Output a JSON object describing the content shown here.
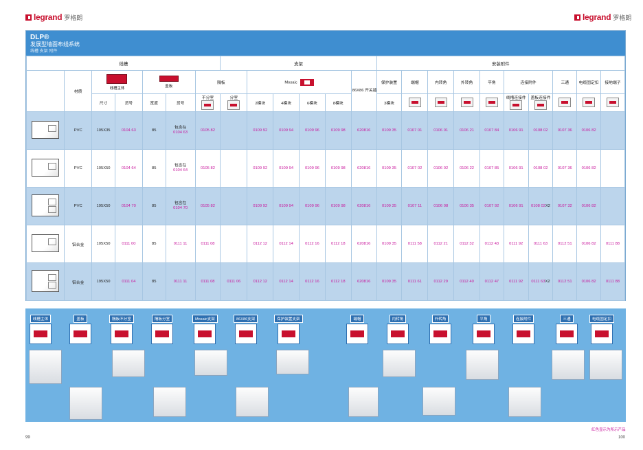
{
  "brand": {
    "word": "legrand",
    "cn": "罗格朗"
  },
  "header": {
    "title": "DLP®",
    "subtitle": "发展型墙面布线系统",
    "crumb": "线槽  支架  附件"
  },
  "groups": {
    "trunking": "线槽",
    "bracket": "支架",
    "accessories": "安装附件"
  },
  "columns": {
    "body": "线槽主体",
    "cover": "盖板",
    "divider": "隔板",
    "mosaic": "Mosaic",
    "box86": "86X86 开关插座",
    "protect": "保护装置",
    "endcap": "端帽",
    "inner": "内转角",
    "outer": "外转角",
    "flat": "平角",
    "joint": "连接附件",
    "tee": "三通",
    "clip": "电缆固定扣",
    "earth": "接地端子",
    "joint_body": "线槽连接件",
    "joint_cover": "盖板连接件"
  },
  "sublabels": {
    "material": "材质",
    "size": "尺寸",
    "code": "货号",
    "width": "宽度",
    "cover_code": "货号",
    "no_div": "不分室",
    "div": "分室",
    "m2": "2模块",
    "m4": "4模块",
    "m6": "6模块",
    "m8": "8模块",
    "p3": "3模块"
  },
  "rows": [
    {
      "mat": "PVC",
      "size": "105X35",
      "code": "0104 63",
      "w": "85",
      "cov_a": "包含在",
      "cov_b": "0104 63",
      "nodiv": "0105 82",
      "div": "",
      "m2": "0109 92",
      "m4": "0109 94",
      "m6": "0109 96",
      "m8": "0109 98",
      "box": "620816",
      "prot": "0109 35",
      "end": "0107 01",
      "inner": "0106 01",
      "outer": "0106 21",
      "flat": "0107 84",
      "jb": "0106 91",
      "jc": "0108 02",
      "jcx": "",
      "tee": "0107 36",
      "clip": "0106 82",
      "earth": ""
    },
    {
      "mat": "PVC",
      "size": "105X50",
      "code": "0104 64",
      "w": "85",
      "cov_a": "包含在",
      "cov_b": "0104 64",
      "nodiv": "0105 82",
      "div": "",
      "m2": "0109 92",
      "m4": "0109 94",
      "m6": "0109 96",
      "m8": "0109 98",
      "box": "620816",
      "prot": "0109 35",
      "end": "0107 02",
      "inner": "0106 02",
      "outer": "0106 22",
      "flat": "0107 85",
      "jb": "0106 91",
      "jc": "0108 02",
      "jcx": "",
      "tee": "0107 36",
      "clip": "0106 82",
      "earth": ""
    },
    {
      "mat": "PVC",
      "size": "195X50",
      "code": "0104 70",
      "w": "85",
      "cov_a": "包含在",
      "cov_b": "0104 70",
      "nodiv": "0105 82",
      "div": "",
      "m2": "0109 92",
      "m4": "0109 94",
      "m6": "0109 96",
      "m8": "0109 98",
      "box": "620816",
      "prot": "0109 35",
      "end": "0107 11",
      "inner": "0106 08",
      "outer": "0106 35",
      "flat": "0107 92",
      "jb": "0106 91",
      "jc": "0108 02",
      "jcx": "X2",
      "tee": "0107 32",
      "clip": "0106 82",
      "earth": ""
    },
    {
      "mat": "铝合金",
      "size": "105X50",
      "code": "0111 00",
      "w": "85",
      "cov_a": "",
      "cov_b": "0111 11",
      "nodiv": "0111 08",
      "div": "",
      "m2": "0112 12",
      "m4": "0112 14",
      "m6": "0112 16",
      "m8": "0112 18",
      "box": "620816",
      "prot": "0109 35",
      "end": "0111 58",
      "inner": "0112 21",
      "outer": "0112 32",
      "flat": "0112 43",
      "jb": "0111 92",
      "jc": "0111 63",
      "jcx": "",
      "tee": "0112 51",
      "clip": "0106 82",
      "earth": "0111 88"
    },
    {
      "mat": "铝合金",
      "size": "195X50",
      "code": "0111 04",
      "w": "85",
      "cov_a": "",
      "cov_b": "0111 11",
      "nodiv": "0111 08",
      "div": "0111 06",
      "m2": "0112 12",
      "m4": "0112 14",
      "m6": "0112 16",
      "m8": "0112 18",
      "box": "620816",
      "prot": "0109 35",
      "end": "0111 61",
      "inner": "0112 29",
      "outer": "0112 40",
      "flat": "0112 47",
      "jb": "0111 92",
      "jc": "0111 63",
      "jcx": "X2",
      "tee": "0112 51",
      "clip": "0106 82",
      "earth": "0111 88"
    }
  ],
  "gallery": [
    "线槽主体",
    "盖板",
    "隔板不分室",
    "隔板分室",
    "Mosaic支架",
    "86X86支架",
    "保护装置支架",
    "端帽",
    "内转角",
    "外转角",
    "平角",
    "连接附件",
    "三通",
    "电缆固定扣"
  ],
  "note": "红色显示为所示产品",
  "pages": {
    "left": "99",
    "right": "100"
  },
  "colors": {
    "brand_red": "#c8102e",
    "header_blue": "#3f8ed0",
    "code_magenta": "#c8149b"
  }
}
